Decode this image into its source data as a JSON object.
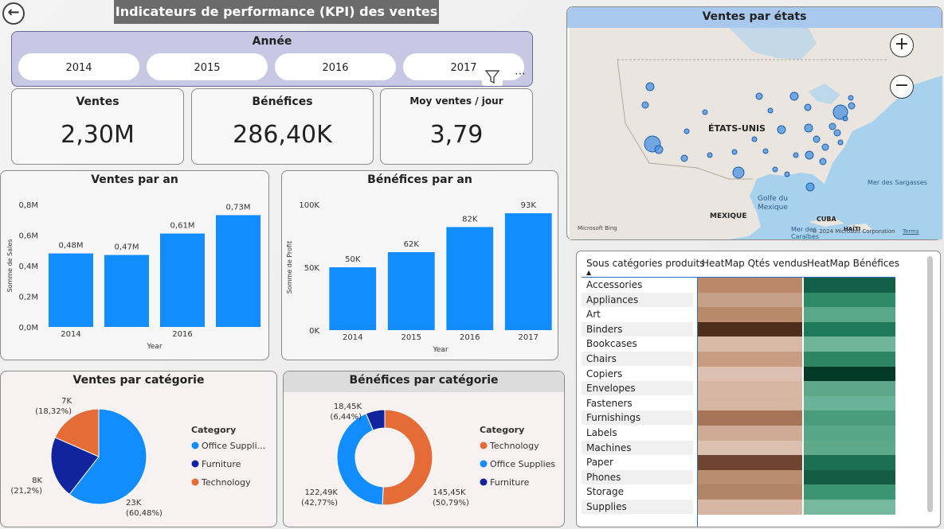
{
  "header": {
    "title": "Indicateurs de performance (KPI) des ventes",
    "back_icon": "back-arrow-icon"
  },
  "year_filter": {
    "title": "Année",
    "options": [
      "2014",
      "2015",
      "2016",
      "2017"
    ],
    "filter_icon": "filter-icon",
    "more_icon": "more-options-icon"
  },
  "kpis": [
    {
      "label": "Ventes",
      "value": "2,30M"
    },
    {
      "label": "Bénéfices",
      "value": "286,40K"
    },
    {
      "label": "Moy ventes / jour",
      "value": "3,79"
    }
  ],
  "sales_by_year": {
    "title": "Ventes par an",
    "chart_data": {
      "type": "bar",
      "title": "Ventes par an",
      "xlabel": "Year",
      "ylabel": "Somme de Sales",
      "categories": [
        "2014",
        "2015",
        "2016",
        "2017"
      ],
      "tick_labels": [
        "2014",
        "",
        "2016",
        ""
      ],
      "values": [
        0.48,
        0.47,
        0.61,
        0.73
      ],
      "data_labels": [
        "0,48M",
        "0,47M",
        "0,61M",
        "0,73M"
      ],
      "yticks": [
        "0,0M",
        "0,2M",
        "0,4M",
        "0,6M",
        "0,8M"
      ],
      "ylim": [
        0,
        0.8
      ],
      "color": "#118DFF"
    }
  },
  "profit_by_year": {
    "title": "Bénéfices par an",
    "chart_data": {
      "type": "bar",
      "title": "Bénéfices par an",
      "xlabel": "Year",
      "ylabel": "Somme de Profit",
      "categories": [
        "2014",
        "2015",
        "2016",
        "2017"
      ],
      "tick_labels": [
        "2014",
        "2015",
        "2016",
        "2017"
      ],
      "values": [
        50,
        62,
        82,
        93
      ],
      "data_labels": [
        "50K",
        "62K",
        "82K",
        "93K"
      ],
      "yticks": [
        "0K",
        "50K",
        "100K"
      ],
      "ylim": [
        0,
        100
      ],
      "color": "#118DFF"
    }
  },
  "map": {
    "title": "Ventes par états",
    "labels": {
      "country": "ÉTATS-UNIS",
      "gulf": "Golfe du Mexique",
      "mexico": "MEXIQUE",
      "cuba": "CUBA",
      "haiti": "HAÏTI",
      "caraibes": "Mer des Caraïbes",
      "sargasses": "Mer des Sargasses",
      "copyright": "© 2024 Microsoft Corporation",
      "terms": "Terms",
      "bing": "Microsoft Bing"
    },
    "zoom_in_icon": "zoom-in-icon",
    "zoom_out_icon": "zoom-out-icon"
  },
  "sales_by_category": {
    "title": "Ventes par catégorie",
    "chart_data": {
      "type": "pie",
      "title": "Ventes par catégorie",
      "legend_title": "Category",
      "legend_entries": [
        "Office Suppli...",
        "Furniture",
        "Technology"
      ],
      "series": [
        {
          "name": "Office Supplies",
          "value": 23,
          "percent": 60.48,
          "label": "23K",
          "pct_label": "(60,48%)",
          "color": "#118DFF"
        },
        {
          "name": "Furniture",
          "value": 8,
          "percent": 21.2,
          "label": "8K",
          "pct_label": "(21,2%)",
          "color": "#12239E"
        },
        {
          "name": "Technology",
          "value": 7,
          "percent": 18.32,
          "label": "7K",
          "pct_label": "(18,32%)",
          "color": "#E66C37"
        }
      ]
    }
  },
  "profit_by_category": {
    "title": "Bénéfices par catégorie",
    "chart_data": {
      "type": "pie",
      "title": "Bénéfices par catégorie",
      "legend_title": "Category",
      "legend_entries": [
        "Technology",
        "Office Supplies",
        "Furniture"
      ],
      "series": [
        {
          "name": "Technology",
          "value": 145.45,
          "percent": 50.79,
          "label": "145,45K",
          "pct_label": "(50,79%)",
          "color": "#E66C37"
        },
        {
          "name": "Office Supplies",
          "value": 122.49,
          "percent": 42.77,
          "label": "122,49K",
          "pct_label": "(42,77%)",
          "color": "#118DFF"
        },
        {
          "name": "Furniture",
          "value": 18.45,
          "percent": 6.44,
          "label": "18,45K",
          "pct_label": "(6,44%)",
          "color": "#12239E"
        }
      ]
    }
  },
  "heatmap_table": {
    "headers": [
      "Sous catégories produits",
      "HeatMap Qtés vendus",
      "HeatMap Bénéfices"
    ],
    "sort_icon": "sort-ascending-icon",
    "rows": [
      {
        "name": "Accessories",
        "qty_color": "#b9896a",
        "profit_color": "#135e48"
      },
      {
        "name": "Appliances",
        "qty_color": "#c6a088",
        "profit_color": "#2f8a6a"
      },
      {
        "name": "Art",
        "qty_color": "#b98a6a",
        "profit_color": "#5aa88c"
      },
      {
        "name": "Binders",
        "qty_color": "#4e2d1c",
        "profit_color": "#1f7a5c"
      },
      {
        "name": "Bookcases",
        "qty_color": "#d8b9a8",
        "profit_color": "#6fb59b"
      },
      {
        "name": "Chairs",
        "qty_color": "#c79c80",
        "profit_color": "#2e8566"
      },
      {
        "name": "Copiers",
        "qty_color": "#dcc1b2",
        "profit_color": "#033a27"
      },
      {
        "name": "Envelopes",
        "qty_color": "#d7b7a4",
        "profit_color": "#5ea78b"
      },
      {
        "name": "Fasteners",
        "qty_color": "#d6b5a3",
        "profit_color": "#6bb29a"
      },
      {
        "name": "Furnishings",
        "qty_color": "#a67558",
        "profit_color": "#4a9c7f"
      },
      {
        "name": "Labels",
        "qty_color": "#cfaa95",
        "profit_color": "#59a78a"
      },
      {
        "name": "Machines",
        "qty_color": "#dbc0b0",
        "profit_color": "#5fa98b"
      },
      {
        "name": "Paper",
        "qty_color": "#6e4530",
        "profit_color": "#1c6f52"
      },
      {
        "name": "Phones",
        "qty_color": "#b98d70",
        "profit_color": "#155c44"
      },
      {
        "name": "Storage",
        "qty_color": "#b28568",
        "profit_color": "#3b9474"
      },
      {
        "name": "Supplies",
        "qty_color": "#d7b7a4",
        "profit_color": "#76b8a0"
      }
    ]
  }
}
